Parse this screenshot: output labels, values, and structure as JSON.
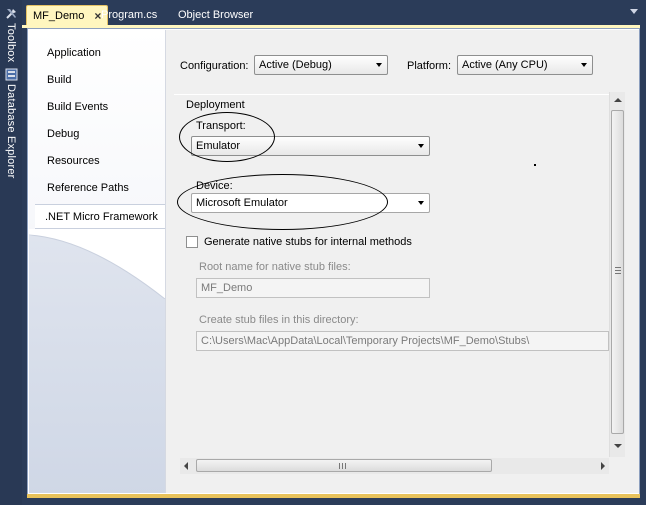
{
  "dock": {
    "toolbox_label": "Toolbox",
    "database_explorer_label": "Database Explorer",
    "toolbox_icon": "toolbox-icon",
    "database_explorer_icon": "database-explorer-icon"
  },
  "tabs": [
    {
      "label": "MF_Demo",
      "active": true,
      "close": "×"
    },
    {
      "label": "Program.cs",
      "active": false
    },
    {
      "label": "Object Browser",
      "active": false
    }
  ],
  "nav": {
    "items": [
      "Application",
      "Build",
      "Build Events",
      "Debug",
      "Resources",
      "Reference Paths",
      ".NET Micro Framework"
    ],
    "selected_index": 6
  },
  "config": {
    "configuration_label": "Configuration:",
    "configuration_value": "Active (Debug)",
    "platform_label": "Platform:",
    "platform_value": "Active (Any CPU)"
  },
  "deployment": {
    "group_label": "Deployment",
    "transport_label": "Transport:",
    "transport_value": "Emulator",
    "device_label": "Device:",
    "device_value": "Microsoft Emulator"
  },
  "native_stubs": {
    "checkbox_label": "Generate native stubs for internal methods",
    "checked": false,
    "root_name_label": "Root name for native stub files:",
    "root_name_value": "MF_Demo",
    "directory_label": "Create stub files in this directory:",
    "directory_value": "C:\\Users\\Mac\\AppData\\Local\\Temporary Projects\\MF_Demo\\Stubs\\"
  },
  "colors": {
    "tab_active": "#fff6bf",
    "chrome": "#2b3c59",
    "accent_band": "#e8c25b"
  }
}
